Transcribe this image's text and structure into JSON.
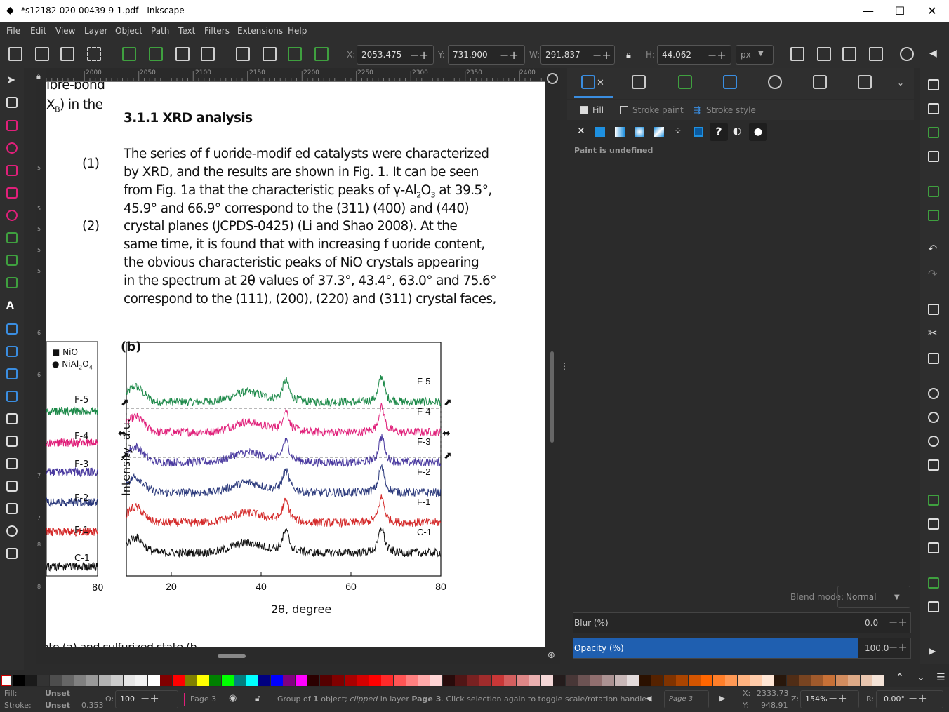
{
  "window": {
    "title": "*s12182-020-00439-9-1.pdf - Inkscape",
    "minimize": "—",
    "maximize": "☐",
    "close": "✕"
  },
  "menu": [
    "File",
    "Edit",
    "View",
    "Layer",
    "Object",
    "Path",
    "Text",
    "Filters",
    "Extensions",
    "Help"
  ],
  "toolbar": {
    "x_label": "X:",
    "x_value": "2053.475",
    "y_label": "Y:",
    "y_value": "731.900",
    "w_label": "W:",
    "w_value": "291.837",
    "h_label": "H:",
    "h_value": "44.062",
    "unit": "px"
  },
  "ruler": {
    "top_ticks": [
      "2000",
      "2050",
      "2100",
      "2150",
      "2200",
      "2250",
      "2300",
      "2350",
      "2400"
    ],
    "left_ticks": [
      "5",
      "5",
      "5",
      "5",
      "5",
      "6",
      "6",
      "7",
      "7",
      "8",
      "8"
    ]
  },
  "document": {
    "top_left_cut1": "ibre-bond",
    "top_left_cut2": "X",
    "top_left_cut2_sub": "B",
    "top_left_cut3": ") in the",
    "heading_num": "3.1.1",
    "heading_text": "XRD analysis",
    "eq1": "(1)",
    "eq2": "(2)",
    "lines": [
      "The series of f uoride-modif ed catalysts were characterized",
      "by XRD, and the results are shown in Fig. 1. It can be seen",
      "from Fig. 1a that the characteristic peaks of γ-Al",
      "45.9° and 66.9° correspond to the (311) (400) and (440)",
      "crystal planes (JCPDS-0425) (Li and Shao 2008). At the",
      "same time, it is found that with increasing f uoride content,",
      "the obvious characteristic peaks of NiO crystals appearing",
      "in the spectrum at 2θ values of 37.3°, 43.4°, 63.0° and 75.6°",
      "correspond to the (111), (200), (220) and (311) crystal faces,"
    ],
    "line3_sub1": "2",
    "line3_mid": "O",
    "line3_sub2": "3",
    "line3_end": " at 39.5°,",
    "caption_cut": "ate (a) and sulfurized state (b"
  },
  "figure_a": {
    "legend": [
      "NiO",
      "NiAl"
    ],
    "legend_sub1": "2",
    "legend_mid": "O",
    "legend_sub2": "4",
    "labels": [
      "F-5",
      "F-4",
      "F-3",
      "F-2",
      "F-1",
      "C-1"
    ],
    "xtick": "80"
  },
  "chart_data": {
    "type": "line",
    "panel_label": "(b)",
    "xlabel": "2θ, degree",
    "ylabel": "Intensity, a.u.",
    "xlim": [
      10,
      80
    ],
    "xticks": [
      "20",
      "40",
      "60",
      "80"
    ],
    "series": [
      {
        "name": "F-5",
        "color": "#1e8a4a",
        "offset": 5
      },
      {
        "name": "F-4",
        "color": "#e0207a",
        "offset": 4
      },
      {
        "name": "F-3",
        "color": "#4b3ba0",
        "offset": 3
      },
      {
        "name": "F-2",
        "color": "#2c3a7c",
        "offset": 2
      },
      {
        "name": "F-1",
        "color": "#d42a2a",
        "offset": 1
      },
      {
        "name": "C-1",
        "color": "#111111",
        "offset": 0
      }
    ]
  },
  "fill_stroke": {
    "tab_fill": "Fill",
    "tab_stroke_paint": "Stroke paint",
    "tab_stroke_style": "Stroke style",
    "paint_status": "Paint is undefined",
    "blend_label": "Blend mode:",
    "blend_value": "Normal",
    "blur_label": "Blur (%)",
    "blur_value": "0.0",
    "opacity_label": "Opacity (%)",
    "opacity_value": "100.0",
    "question": "?"
  },
  "status": {
    "fill_label": "Fill:",
    "fill_value": "Unset",
    "stroke_label": "Stroke:",
    "stroke_value": "Unset",
    "stroke_width": "0.353",
    "o_label": "O:",
    "o_value": "100",
    "layer": "Page 3",
    "message_pre": "Group of ",
    "message_count": "1",
    "message_mid": " object; ",
    "message_clipped": "clipped",
    "message_inlayer": " in layer ",
    "message_layer": "Page 3",
    "message_post": ". Click selection again to toggle scale/rotation handles.",
    "page_select": "Page 3",
    "x_label": "X:",
    "x_value": "2333.73",
    "y_label": "Y:",
    "y_value": "948.91",
    "z_label": "Z:",
    "zoom": "154%",
    "r_label": "R:",
    "rotation": "0.00°"
  },
  "colors": {
    "accent": "#1f5fb0",
    "panel": "#2b2b2b",
    "green": "#1e8a4a",
    "pink": "#e0207a"
  }
}
